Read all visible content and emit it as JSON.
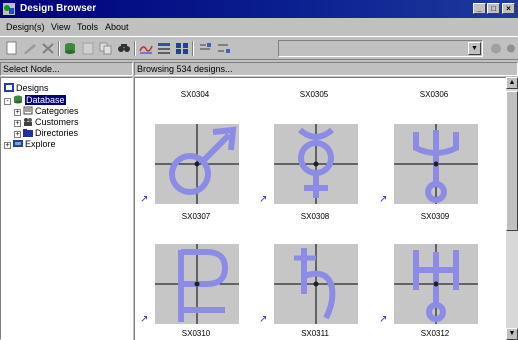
{
  "window": {
    "title": "Design Browser",
    "minimize_glyph": "_",
    "maximize_glyph": "□",
    "close_glyph": "×"
  },
  "menu": [
    "Design(s)",
    "View",
    "Tools",
    "About"
  ],
  "panes": {
    "left_header": "Select Node...",
    "right_header": "Browsing 534 designs..."
  },
  "tree": [
    {
      "label": "Designs",
      "icon": "designs-icon"
    },
    {
      "label": "Database",
      "icon": "database-icon",
      "selected": true,
      "expander": "-"
    },
    {
      "label": "Categories",
      "icon": "categories-icon",
      "expander": "+"
    },
    {
      "label": "Customers",
      "icon": "customers-icon",
      "expander": "+"
    },
    {
      "label": "Directories",
      "icon": "folder-icon",
      "expander": "+"
    },
    {
      "label": "Explore",
      "icon": "explore-icon",
      "expander": "+"
    }
  ],
  "grid": {
    "top_labels": [
      "SX0304",
      "SX0305",
      "SX0306"
    ],
    "rows": [
      [
        "SX0307",
        "SX0308",
        "SX0309"
      ],
      [
        "SX0310",
        "SX0311",
        "SX0312"
      ]
    ],
    "shortcut_glyph": "↗"
  },
  "colors": {
    "title_bar": "#00007b",
    "selection": "#000080",
    "symbol": "#8c8ce6",
    "thumb_bg": "#c6c6c6"
  }
}
